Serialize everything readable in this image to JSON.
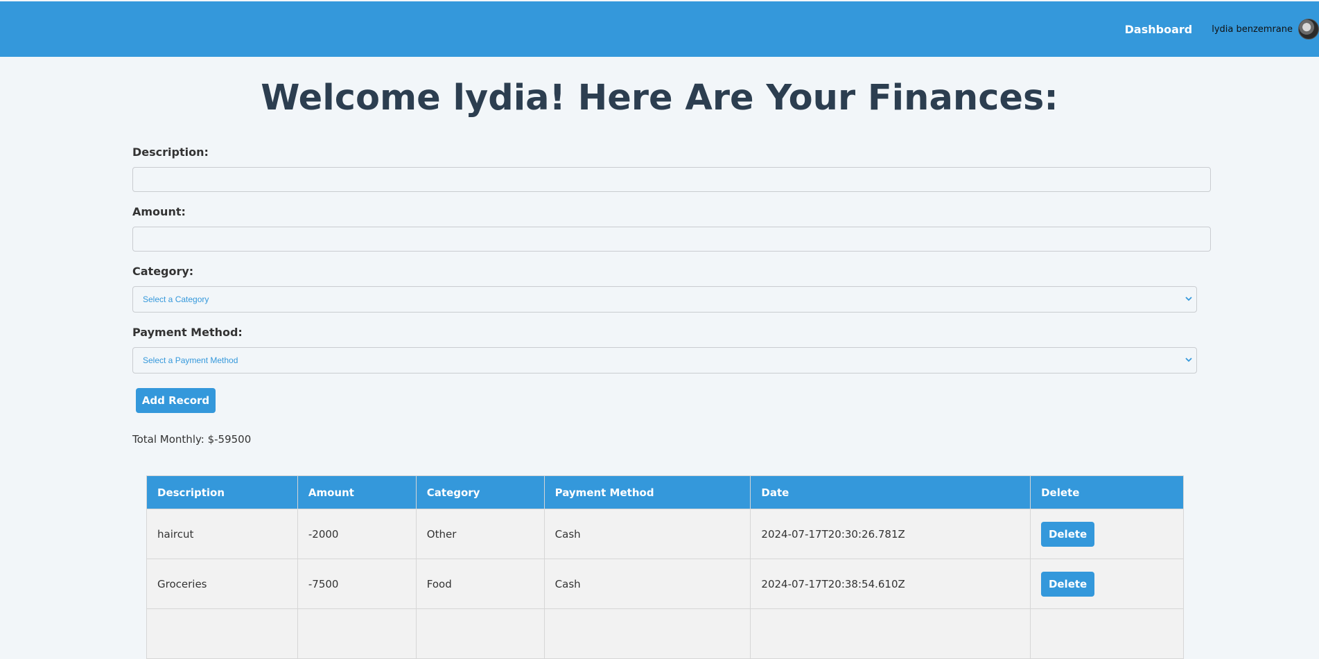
{
  "navbar": {
    "dashboard_label": "Dashboard",
    "user_name": "lydia benzemrane",
    "bg_color": "#3498db"
  },
  "page_title": "Welcome lydia! Here Are Your Finances:",
  "form": {
    "description_label": "Description:",
    "description_value": "",
    "amount_label": "Amount:",
    "amount_value": "",
    "category_label": "Category:",
    "category_selected": "Select a Category",
    "payment_label": "Payment Method:",
    "payment_selected": "Select a Payment Method",
    "add_button_label": "Add Record"
  },
  "total_monthly": "Total Monthly: $-59500",
  "table": {
    "headers": [
      "Description",
      "Amount",
      "Category",
      "Payment Method",
      "Date",
      "Delete"
    ],
    "rows": [
      {
        "description": "haircut",
        "amount": "-2000",
        "category": "Other",
        "payment": "Cash",
        "date": "2024-07-17T20:30:26.781Z",
        "delete_label": "Delete"
      },
      {
        "description": "Groceries",
        "amount": "-7500",
        "category": "Food",
        "payment": "Cash",
        "date": "2024-07-17T20:38:54.610Z",
        "delete_label": "Delete"
      },
      {
        "description": "",
        "amount": "",
        "category": "",
        "payment": "",
        "date": "",
        "delete_label": ""
      }
    ]
  }
}
